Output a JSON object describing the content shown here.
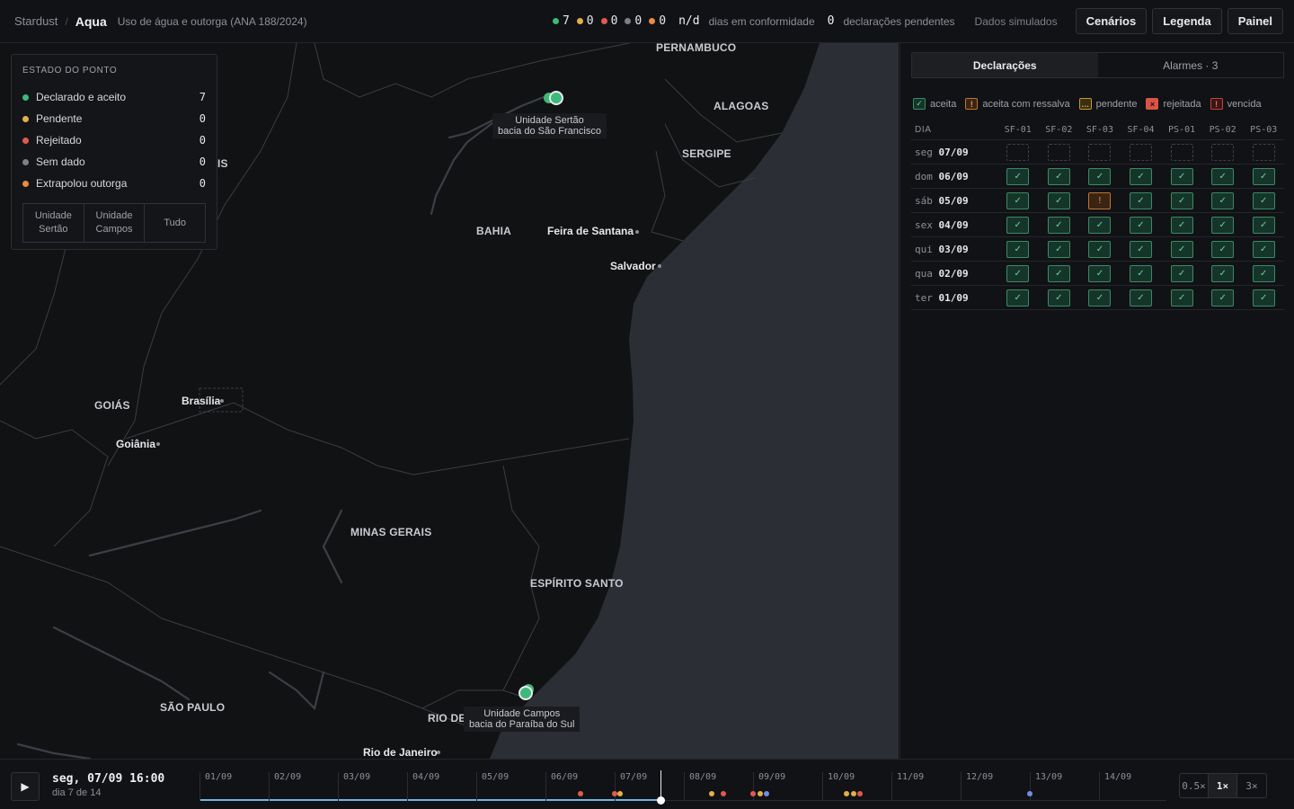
{
  "header": {
    "brand": "Stardust",
    "separator": "/",
    "app": "Aqua",
    "subtitle": "Uso de água e outorga (ANA 188/2024)",
    "counts": [
      {
        "value": "7",
        "color": "#3fb97a"
      },
      {
        "value": "0",
        "color": "#e2b04a"
      },
      {
        "value": "0",
        "color": "#e05a4f"
      },
      {
        "value": "0",
        "color": "#7c8088"
      },
      {
        "value": "0",
        "color": "#ea8a45"
      }
    ],
    "conformity_value": "n/d",
    "conformity_label": "dias em conformidade",
    "pending_value": "0",
    "pending_label": "declarações pendentes",
    "simulated": "Dados simulados",
    "buttons": {
      "scenarios": "Cenários",
      "legend": "Legenda",
      "panel": "Painel"
    }
  },
  "map": {
    "states": [
      {
        "id": "pernambuco",
        "text": "PERNAMBUCO"
      },
      {
        "id": "alagoas",
        "text": "ALAGOAS"
      },
      {
        "id": "sergipe",
        "text": "SERGIPE"
      },
      {
        "id": "bahia",
        "text": "BAHIA"
      },
      {
        "id": "goias",
        "text": "GOIÁS"
      },
      {
        "id": "minas",
        "text": "MINAS GERAIS"
      },
      {
        "id": "espirito",
        "text": "ESPÍRITO SANTO"
      },
      {
        "id": "saopaulo",
        "text": "SÃO PAULO"
      },
      {
        "id": "riode",
        "text": "RIO DE"
      },
      {
        "id": "clipped",
        "text": "IS"
      }
    ],
    "cities": [
      {
        "id": "feira",
        "text": "Feira de Santana"
      },
      {
        "id": "salvador",
        "text": "Salvador"
      },
      {
        "id": "brasilia",
        "text": "Brasília"
      },
      {
        "id": "goiania",
        "text": "Goiânia"
      },
      {
        "id": "rio",
        "text": "Rio de Janeiro"
      }
    ],
    "units": [
      {
        "id": "sertao",
        "name": "Unidade Sertão",
        "basin": "bacia do São Francisco"
      },
      {
        "id": "campos",
        "name": "Unidade Campos",
        "basin": "bacia do Paraíba do Sul"
      }
    ]
  },
  "legend": {
    "title": "ESTADO DO PONTO",
    "items": [
      {
        "label": "Declarado e aceito",
        "count": "7",
        "color": "#3fb97a"
      },
      {
        "label": "Pendente",
        "count": "0",
        "color": "#e2b04a"
      },
      {
        "label": "Rejeitado",
        "count": "0",
        "color": "#e05a4f"
      },
      {
        "label": "Sem dado",
        "count": "0",
        "color": "#7c8088"
      },
      {
        "label": "Extrapolou outorga",
        "count": "0",
        "color": "#ea8a45"
      }
    ],
    "filters": {
      "a": "Unidade\nSertão",
      "b": "Unidade\nCampos",
      "c": "Tudo"
    }
  },
  "side": {
    "tabs": {
      "declarations": "Declarações",
      "alarms": "Alarmes · 3"
    },
    "keys": [
      {
        "label": "aceita",
        "glyph": "✓",
        "kind": "ok"
      },
      {
        "label": "aceita com ressalva",
        "glyph": "!",
        "kind": "warn"
      },
      {
        "label": "pendente",
        "glyph": "…",
        "kind": "pend"
      },
      {
        "label": "rejeitada",
        "glyph": "×",
        "kind": "rej"
      },
      {
        "label": "vencida",
        "glyph": "!",
        "kind": "late"
      }
    ],
    "day_header": "DIA",
    "points": [
      "SF-01",
      "SF-02",
      "SF-03",
      "SF-04",
      "PS-01",
      "PS-02",
      "PS-03"
    ],
    "rows": [
      {
        "wd": "seg",
        "date": "07/09",
        "cells": [
          "e",
          "e",
          "e",
          "e",
          "e",
          "e",
          "e"
        ]
      },
      {
        "wd": "dom",
        "date": "06/09",
        "cells": [
          "ok",
          "ok",
          "ok",
          "ok",
          "ok",
          "ok",
          "ok"
        ]
      },
      {
        "wd": "sáb",
        "date": "05/09",
        "cells": [
          "ok",
          "ok",
          "warn",
          "ok",
          "ok",
          "ok",
          "ok"
        ]
      },
      {
        "wd": "sex",
        "date": "04/09",
        "cells": [
          "ok",
          "ok",
          "ok",
          "ok",
          "ok",
          "ok",
          "ok"
        ]
      },
      {
        "wd": "qui",
        "date": "03/09",
        "cells": [
          "ok",
          "ok",
          "ok",
          "ok",
          "ok",
          "ok",
          "ok"
        ]
      },
      {
        "wd": "qua",
        "date": "02/09",
        "cells": [
          "ok",
          "ok",
          "ok",
          "ok",
          "ok",
          "ok",
          "ok"
        ]
      },
      {
        "wd": "ter",
        "date": "01/09",
        "cells": [
          "ok",
          "ok",
          "ok",
          "ok",
          "ok",
          "ok",
          "ok"
        ]
      }
    ]
  },
  "timeline": {
    "play_icon": "▶",
    "current": "seg, 07/09 16:00",
    "day_label": "dia 7 de 14",
    "days": [
      "01/09",
      "02/09",
      "03/09",
      "04/09",
      "05/09",
      "06/09",
      "07/09",
      "08/09",
      "09/09",
      "10/09",
      "11/09",
      "12/09",
      "13/09",
      "14/09"
    ],
    "progress": 0.477,
    "events": [
      {
        "day": 5.5,
        "color": "#e05a4f"
      },
      {
        "day": 6.0,
        "color": "#e05a4f"
      },
      {
        "day": 6.08,
        "color": "#e2b04a"
      },
      {
        "day": 7.4,
        "color": "#e2b04a"
      },
      {
        "day": 7.57,
        "color": "#e05a4f"
      },
      {
        "day": 8.0,
        "color": "#e05a4f"
      },
      {
        "day": 8.1,
        "color": "#e2b04a"
      },
      {
        "day": 8.2,
        "color": "#6f8fe0"
      },
      {
        "day": 9.35,
        "color": "#e2b04a"
      },
      {
        "day": 9.45,
        "color": "#e2b04a"
      },
      {
        "day": 9.55,
        "color": "#e05a4f"
      },
      {
        "day": 12.0,
        "color": "#6f8fe0"
      }
    ],
    "speeds": [
      "0.5×",
      "1×",
      "3×"
    ],
    "active_speed": "1×"
  }
}
